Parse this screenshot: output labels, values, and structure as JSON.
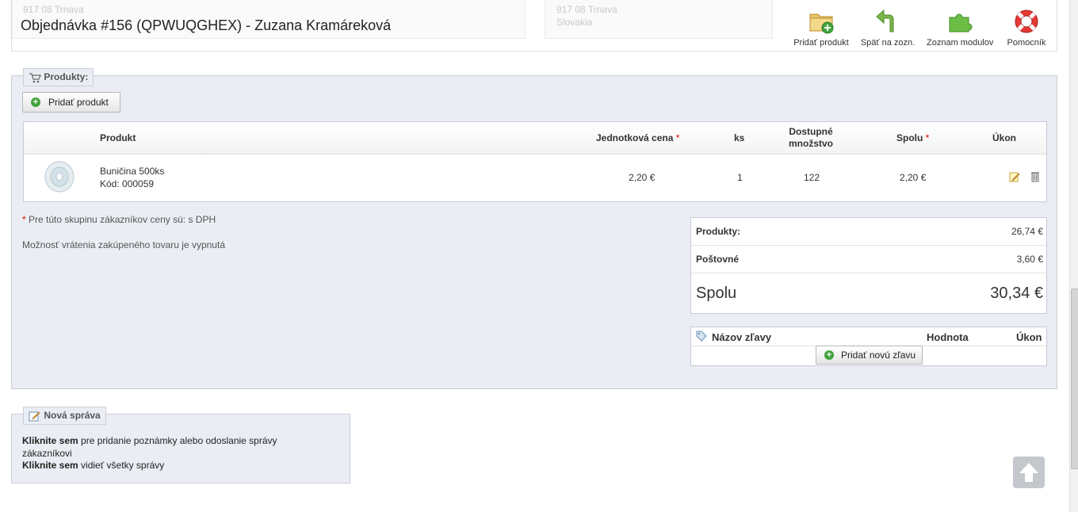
{
  "header": {
    "title": "Objednávka #156 (QPWUQGHEX) - Zuzana Kramáreková",
    "ghost_left": [
      "917 08 Trnava",
      "Slovakia"
    ],
    "ghost_right": [
      "917 08 Trnava",
      "Slovakia"
    ],
    "tools": [
      {
        "label": "Pridať produkt",
        "icon": "folder-add-icon"
      },
      {
        "label": "Späť na zozn.",
        "icon": "back-arrow-icon"
      },
      {
        "label": "Zoznam modulov",
        "icon": "puzzle-icon"
      },
      {
        "label": "Pomocník",
        "icon": "lifebuoy-icon"
      }
    ]
  },
  "products": {
    "legend": "Produkty:",
    "add_button": "Pridať produkt",
    "columns": {
      "product": "Produkt",
      "unit_price": "Jednotková cena",
      "qty": "ks",
      "stock": "Dostupné množstvo",
      "total": "Spolu",
      "action": "Úkon"
    },
    "rows": [
      {
        "name": "Buničina 500ks",
        "code": "Kód: 000059",
        "unit_price": "2,20 €",
        "qty": "1",
        "stock": "122",
        "total": "2,20 €"
      }
    ],
    "note_star": "*",
    "note": "Pre túto skupinu zákazníkov ceny sú: s DPH",
    "returns_note": "Možnosť vrátenia zakúpeného tovaru je vypnutá"
  },
  "totals": {
    "products_label": "Produkty:",
    "products_value": "26,74 €",
    "shipping_label": "Poštovné",
    "shipping_value": "3,60 €",
    "total_label": "Spolu",
    "total_value": "30,34 €"
  },
  "discounts": {
    "name_header": "Názov zľavy",
    "value_header": "Hodnota",
    "action_header": "Úkon",
    "add_button": "Pridať novú zľavu"
  },
  "message": {
    "legend": "Nová správa",
    "line1_bold": "Kliknite sem",
    "line1_rest": "pre pridanie poznámky alebo odoslanie správy zákazníkovi",
    "line2_bold": "Kliknite sem",
    "line2_rest": "vidieť všetky správy"
  },
  "colors": {
    "fieldset_bg": "#ebedf4",
    "accent_green": "#43a43d",
    "required_star": "#dd0000"
  }
}
